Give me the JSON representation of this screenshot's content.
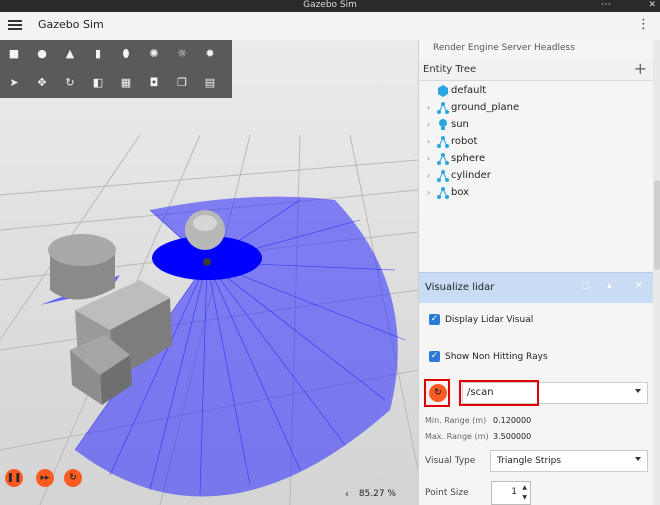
{
  "window": {
    "title": "Gazebo Sim"
  },
  "appbar": {
    "title": "Gazebo Sim"
  },
  "toolbar": {
    "row1": [
      "box-icon",
      "sphere-icon",
      "cone-icon",
      "cylinder-icon",
      "capsule-icon",
      "point-light-icon",
      "directional-light-icon",
      "spot-light-icon"
    ],
    "row2": [
      "select-icon",
      "translate-icon",
      "rotate-icon",
      "snap-icon",
      "grid-icon",
      "camera-icon",
      "copy-icon",
      "paste-icon"
    ]
  },
  "status": {
    "rtf": "85.27 %"
  },
  "panel": {
    "render_engine": "Render Engine Server Headless",
    "entity_tree_label": "Entity Tree",
    "entities": [
      "default",
      "ground_plane",
      "sun",
      "robot",
      "sphere",
      "cylinder",
      "box"
    ],
    "visualize_lidar": {
      "title": "Visualize lidar",
      "display_lidar": "Display Lidar Visual",
      "show_non_hitting": "Show Non Hitting Rays",
      "topic": "/scan",
      "min_range_label": "Min. Range (m)",
      "min_range_value": "0.120000",
      "max_range_label": "Max. Range (m)",
      "max_range_value": "3.500000",
      "visual_type_label": "Visual Type",
      "visual_type_value": "Triangle Strips",
      "point_size_label": "Point Size",
      "point_size_value": "1"
    }
  },
  "colors": {
    "accent": "#ff5b22",
    "lidar": "#0000ff",
    "highlight": "#e00000"
  }
}
